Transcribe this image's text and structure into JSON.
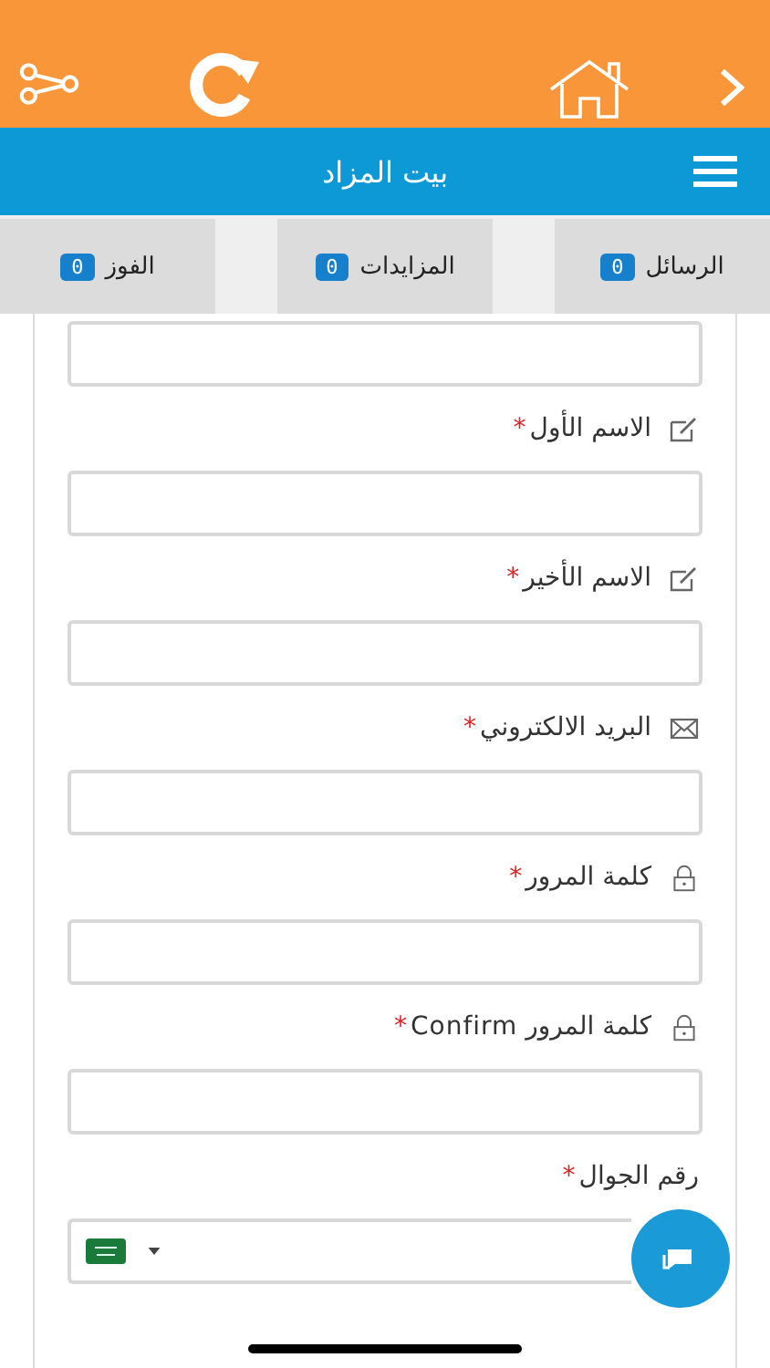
{
  "header": {
    "title": "بيت المزاد"
  },
  "tabs": [
    {
      "label": "الرسائل",
      "count": "0"
    },
    {
      "label": "المزايدات",
      "count": "0"
    },
    {
      "label": "الفوز",
      "count": "0"
    }
  ],
  "fields": [
    {
      "kind": "plain"
    },
    {
      "kind": "name",
      "label": "الاسم الأول",
      "asterisk": "*"
    },
    {
      "kind": "name",
      "label": "الاسم الأخير",
      "asterisk": "*"
    },
    {
      "kind": "email",
      "label": "البريد الالكتروني",
      "asterisk": "*"
    },
    {
      "kind": "password",
      "label": "كلمة المرور",
      "asterisk": "*"
    },
    {
      "kind": "password",
      "label": "كلمة المرور Confirm",
      "asterisk": "*"
    },
    {
      "kind": "phone",
      "label": "رقم الجوال",
      "asterisk": "*"
    }
  ]
}
